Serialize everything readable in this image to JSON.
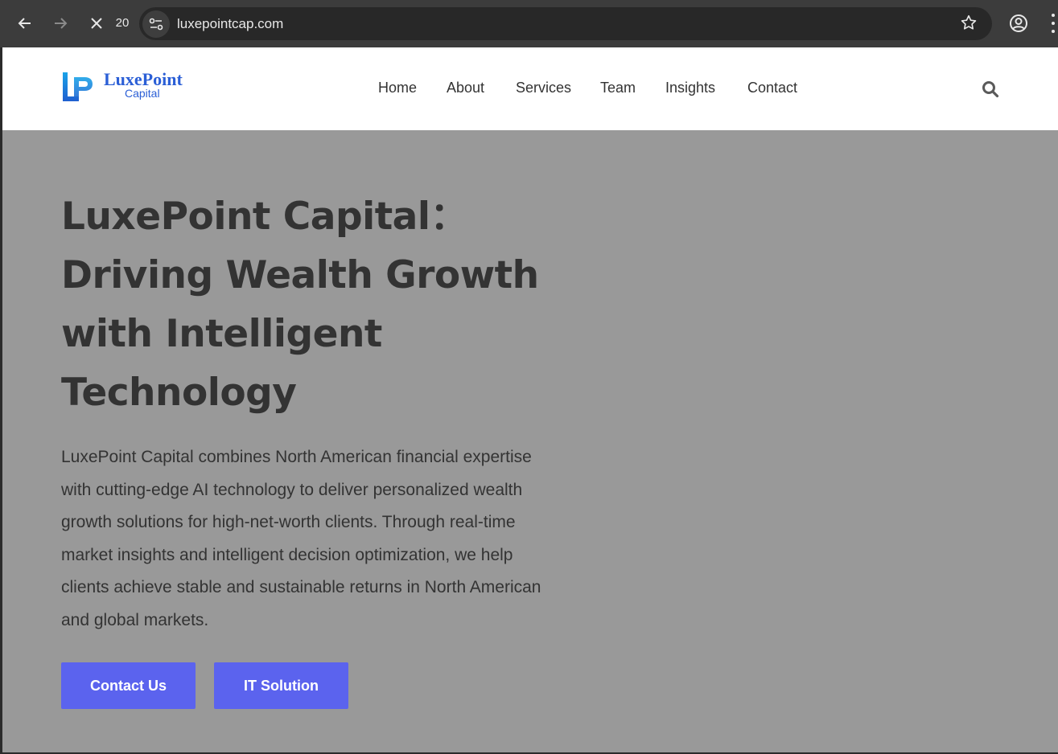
{
  "browser": {
    "back_icon": "arrow-left-icon",
    "forward_icon": "arrow-right-icon",
    "stop_icon": "close-icon",
    "tab_count": "20",
    "url": "luxepointcap.com",
    "site_info_icon": "tune-icon",
    "bookmark_icon": "star-icon",
    "profile_icon": "account-icon",
    "menu_icon": "kebab-icon"
  },
  "header": {
    "logo_brand": "LuxePoint",
    "logo_sub": "Capital",
    "nav": [
      "Home",
      "About",
      "Services",
      "Team",
      "Insights",
      "Contact"
    ],
    "search_icon": "search-icon"
  },
  "hero": {
    "title_lines": [
      "LuxePoint Capital：",
      "Driving Wealth Growth",
      "with Intelligent",
      "Technology"
    ],
    "description": "LuxePoint Capital combines North American financial expertise with cutting-edge AI technology to deliver personalized wealth growth solutions for high-net-worth clients. Through real-time market insights and intelligent decision optimization, we help clients achieve stable and sustainable returns in North American and global markets.",
    "buttons": [
      "Contact Us",
      "IT Solution"
    ]
  },
  "colors": {
    "overlay": "#999999",
    "button": "#5b63ee",
    "brand": "#2b5fd6",
    "text": "#333333"
  }
}
